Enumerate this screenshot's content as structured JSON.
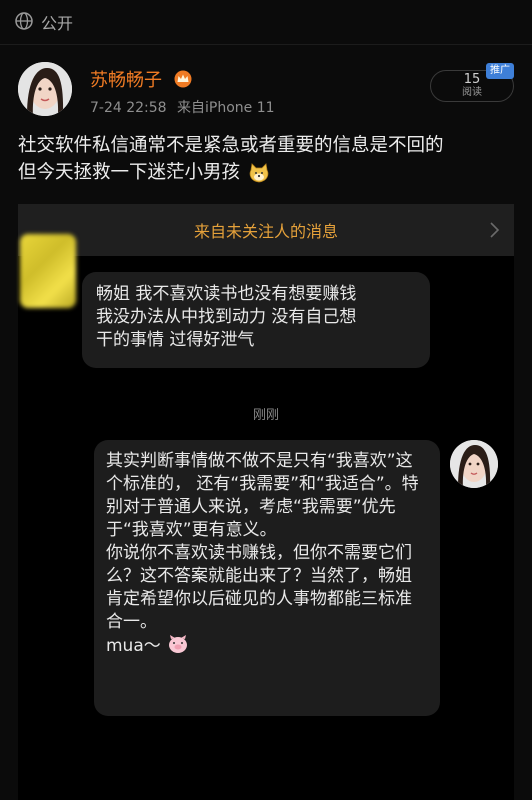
{
  "topbar": {
    "visibility_label": "公开",
    "visibility_icon": "globe-icon"
  },
  "post": {
    "author_name": "苏畅畅子",
    "author_badge": "crown-icon",
    "date": "7-24 22:58",
    "source": "来自iPhone 11",
    "reads_count": "15",
    "reads_label": "阅读",
    "promo_badge": "推广",
    "text_line1": "社交软件私信通常不是紧急或者重要的信息是不回的",
    "text_line2": "但今天拯救一下迷茫小男孩"
  },
  "screenshot": {
    "banner_text": "来自未关注人的消息",
    "incoming_message": [
      "畅姐 我不喜欢读书也没有想要赚钱",
      "我没办法从中找到动力 没有自己想",
      "干的事情 过得好泄气"
    ],
    "timestamp": "刚刚",
    "reply_paragraphs": [
      "其实判断事情做不做不是只有“我喜欢”这个标准的， 还有“我需要”和“我适合”。特别对于普通人来说，考虑“我需要”优先于“我喜欢”更有意义。",
      "你说你不喜欢读书赚钱，但你不需要它们么？这不答案就能出来了？当然了，畅姐肯定希望你以后碰见的人事物都能三标准合一。",
      "mua～"
    ]
  },
  "colors": {
    "accent": "#f07b24",
    "banner_text": "#e5a13a",
    "badge": "#3e7fd8"
  }
}
